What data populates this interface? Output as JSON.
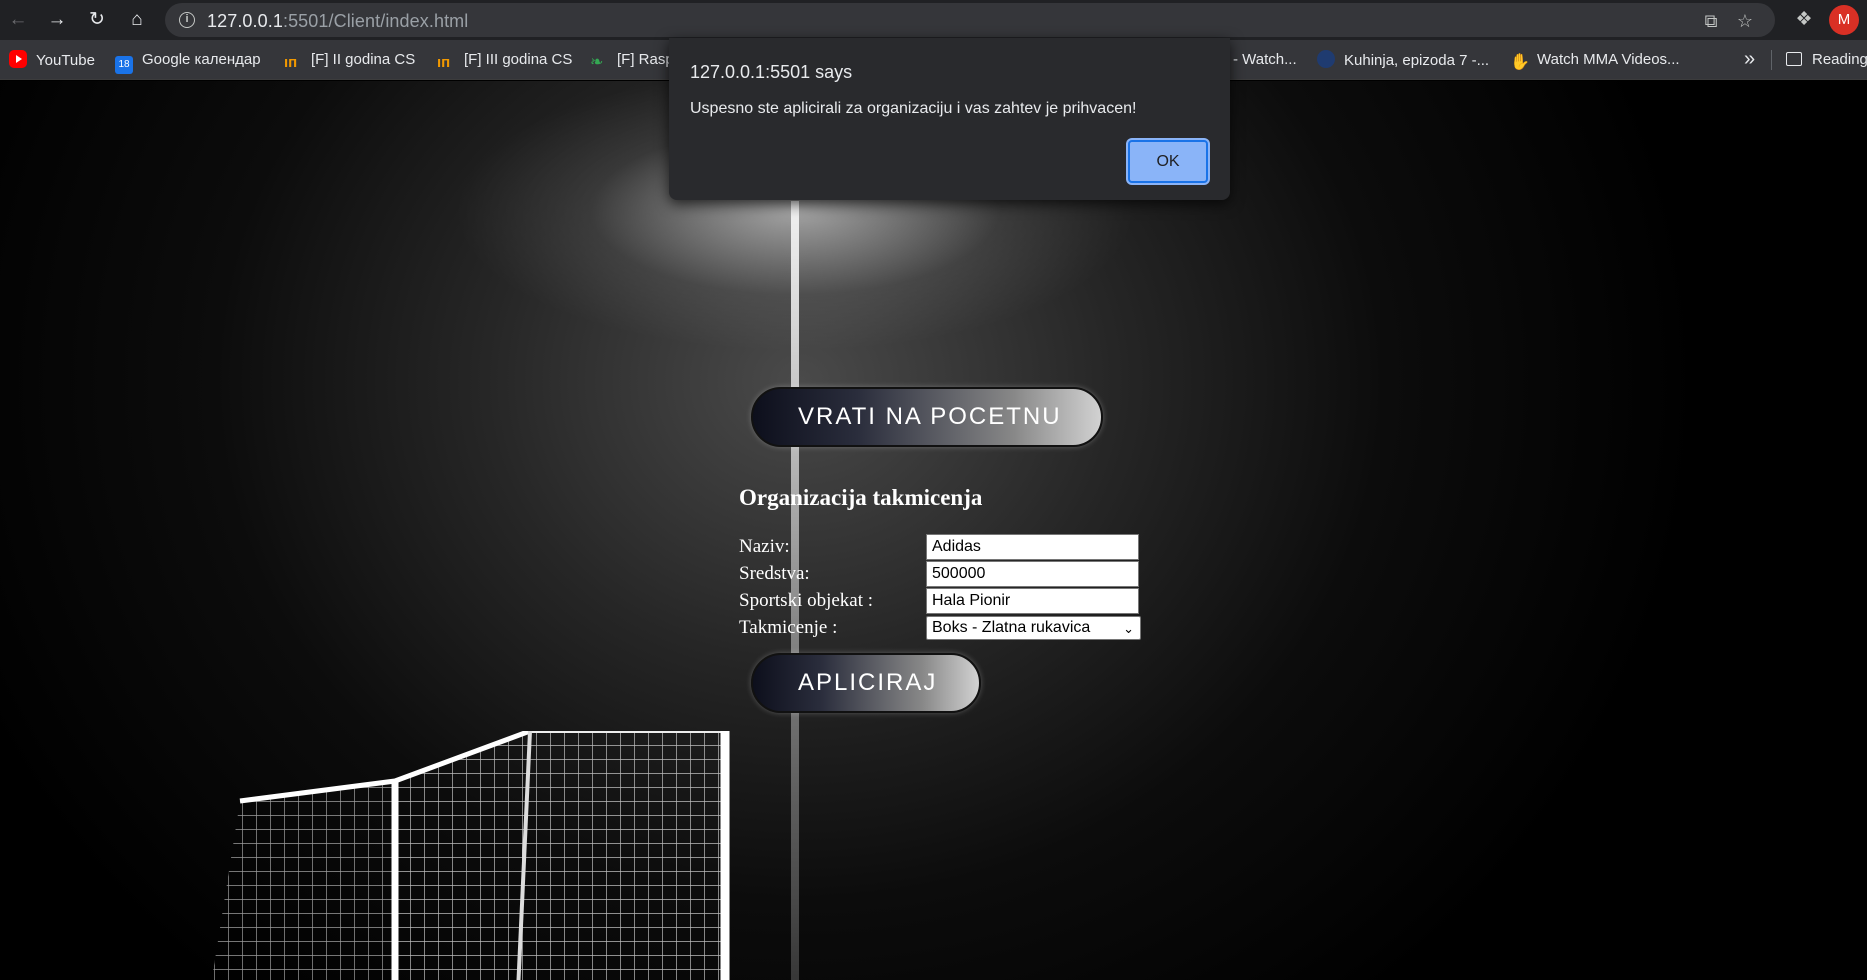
{
  "browser": {
    "url_host": "127.0.0.1",
    "url_rest": ":5501/Client/index.html",
    "profile_initial": "M",
    "icons": {
      "back": "arrow-left-icon",
      "forward": "arrow-right-icon",
      "reload": "reload-icon",
      "home": "home-icon",
      "share": "share-icon",
      "bookmark": "star-icon",
      "extensions": "puzzle-icon"
    }
  },
  "bookmarks": [
    {
      "label": "YouTube",
      "icon": "youtube-icon"
    },
    {
      "label": "Google календар",
      "icon": "calendar-icon",
      "badge": "18"
    },
    {
      "label": "[F] II godina CS",
      "icon": "ims-icon"
    },
    {
      "label": "[F] III godina CS",
      "icon": "ims-icon"
    },
    {
      "label": "[F] Rasp",
      "icon": "leaf-icon"
    },
    {
      "label": "- Watch...",
      "icon": ""
    },
    {
      "label": "Kuhinja, epizoda 7 -...",
      "icon": "site-icon"
    },
    {
      "label": "Watch MMA Videos...",
      "icon": "mma-icon"
    }
  ],
  "bookmarks_more": "»",
  "reading_list": "Reading",
  "dialog": {
    "title": "127.0.0.1:5501 says",
    "message": "Uspesno ste aplicirali za organizaciju i vas zahtev je prihvacen!",
    "ok_label": "OK"
  },
  "page": {
    "back_button": "VRATI NA POCETNU",
    "form_title": "Organizacija takmicenja",
    "fields": {
      "naziv": {
        "label": "Naziv:",
        "value": "Adidas"
      },
      "sredstva": {
        "label": "Sredstva:",
        "value": "500000"
      },
      "objekat": {
        "label": "Sportski objekat :",
        "value": "Hala Pionir"
      },
      "takmicenje": {
        "label": "Takmicenje :",
        "value": "Boks - Zlatna rukavica"
      }
    },
    "apply_button": "APLICIRAJ"
  }
}
